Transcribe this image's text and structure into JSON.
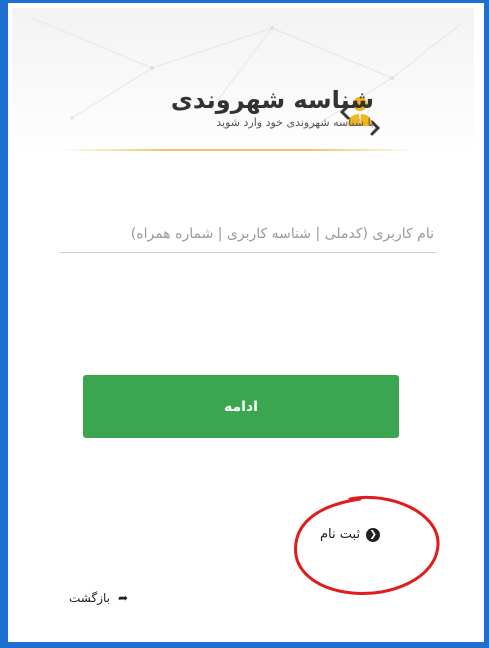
{
  "brand": {
    "title": "شناسه شهروندی",
    "subtitle": "با شناسه شهروندی خود وارد شوید",
    "logo_icon": "citizen-id-logo-icon",
    "accent_color": "#e9b824"
  },
  "login": {
    "username_placeholder": "نام کاربری (کدملی | شناسه کاربری | شماره همراه)",
    "continue_label": "ادامه",
    "continue_color": "#3aa650"
  },
  "links": {
    "register_label": "ثبت نام",
    "register_icon": "chevron-left-circle-icon",
    "back_label": "بازگشت",
    "back_icon": "share-arrow-icon"
  },
  "annotation": {
    "color": "#e01c1c",
    "icon": "red-circle-highlight"
  }
}
